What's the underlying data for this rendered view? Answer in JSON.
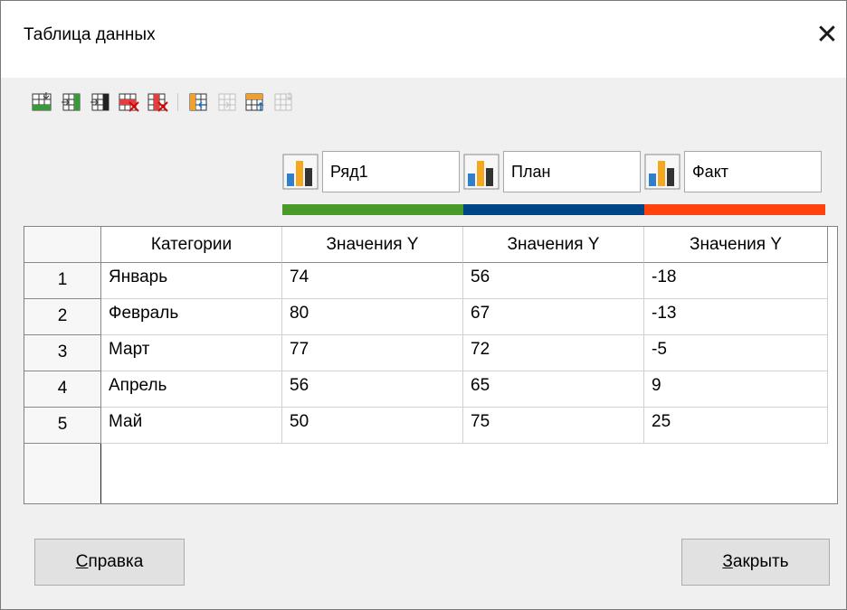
{
  "window": {
    "title": "Таблица данных"
  },
  "toolbar": {
    "icons": [
      "insert-row-icon",
      "insert-series-icon",
      "insert-text-column-icon",
      "delete-row-icon",
      "delete-series-icon",
      "move-series-left-icon",
      "move-series-right-icon",
      "move-row-up-icon",
      "move-row-down-icon"
    ]
  },
  "series": [
    {
      "name": "Ряд1",
      "color": "#4a9a2a"
    },
    {
      "name": "План",
      "color": "#004586"
    },
    {
      "name": "Факт",
      "color": "#ff420e"
    }
  ],
  "table": {
    "headers": [
      "Категории",
      "Значения Y",
      "Значения Y",
      "Значения Y"
    ],
    "rows": [
      {
        "num": "1",
        "category": "Январь",
        "values": [
          "74",
          "56",
          "-18"
        ]
      },
      {
        "num": "2",
        "category": "Февраль",
        "values": [
          "80",
          "67",
          "-13"
        ]
      },
      {
        "num": "3",
        "category": "Март",
        "values": [
          "77",
          "72",
          "-5"
        ]
      },
      {
        "num": "4",
        "category": "Апрель",
        "values": [
          "56",
          "65",
          "9"
        ]
      },
      {
        "num": "5",
        "category": "Май",
        "values": [
          "50",
          "75",
          "25"
        ]
      }
    ]
  },
  "buttons": {
    "help_first": "С",
    "help_rest": "правка",
    "close_first": "З",
    "close_rest": "акрыть"
  }
}
